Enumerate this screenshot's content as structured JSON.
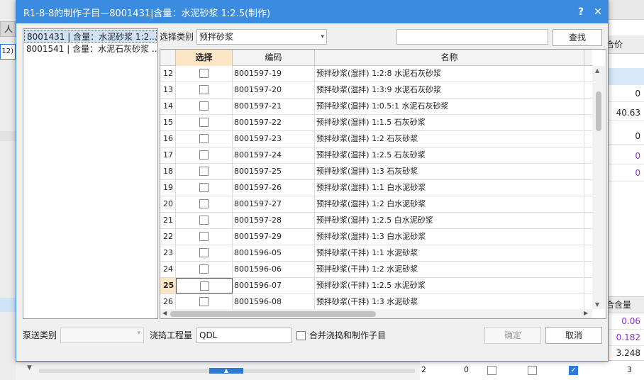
{
  "dialog": {
    "title": "R1-8-8的制作子目—8001431|含量：水泥砂浆 1:2.5(制作)",
    "help_glyph": "?",
    "close_glyph": "✕",
    "accent_color": "#3b8ce0"
  },
  "left_list": {
    "items": [
      "8001431 | 含量：水泥砂浆 1:2....",
      "8001541 | 含量：水泥石灰砂浆 ..."
    ]
  },
  "filter": {
    "category_label": "选择类别",
    "category_value": "预拌砂浆",
    "search_value": "",
    "search_button": "查找"
  },
  "grid": {
    "headers": [
      "",
      "选择",
      "编码",
      "名称"
    ],
    "current_row": "25",
    "rows": [
      {
        "num": "12",
        "code": "8001597-19",
        "name": "预拌砂浆(湿拌) 1:2:8 水泥石灰砂浆"
      },
      {
        "num": "13",
        "code": "8001597-20",
        "name": "预拌砂浆(湿拌) 1:3:9 水泥石灰砂浆"
      },
      {
        "num": "14",
        "code": "8001597-21",
        "name": "预拌砂浆(湿拌) 1:0.5:1 水泥石灰砂浆"
      },
      {
        "num": "15",
        "code": "8001597-22",
        "name": "预拌砂浆(湿拌) 1:1.5 石灰砂浆"
      },
      {
        "num": "16",
        "code": "8001597-23",
        "name": "预拌砂浆(湿拌) 1:2 石灰砂浆"
      },
      {
        "num": "17",
        "code": "8001597-24",
        "name": "预拌砂浆(湿拌) 1:2.5 石灰砂浆"
      },
      {
        "num": "18",
        "code": "8001597-25",
        "name": "预拌砂浆(湿拌) 1:3 石灰砂浆"
      },
      {
        "num": "19",
        "code": "8001597-26",
        "name": "预拌砂浆(湿拌) 1:1 白水泥砂浆"
      },
      {
        "num": "20",
        "code": "8001597-27",
        "name": "预拌砂浆(湿拌) 1:2 白水泥砂浆"
      },
      {
        "num": "21",
        "code": "8001597-28",
        "name": "预拌砂浆(湿拌) 1:2.5 白水泥砂浆"
      },
      {
        "num": "22",
        "code": "8001597-29",
        "name": "预拌砂浆(湿拌) 1:3 白水泥砂浆"
      },
      {
        "num": "23",
        "code": "8001596-05",
        "name": "预拌砂浆(干拌) 1:1 水泥砂浆"
      },
      {
        "num": "24",
        "code": "8001596-06",
        "name": "预拌砂浆(干拌) 1:2 水泥砂浆"
      },
      {
        "num": "25",
        "code": "8001596-07",
        "name": "预拌砂浆(干拌) 1:2.5 水泥砂浆"
      },
      {
        "num": "26",
        "code": "8001596-08",
        "name": "预拌砂浆(干拌) 1:3 水泥砂浆"
      }
    ]
  },
  "bottom": {
    "pump_label": "泵送类别",
    "pump_value": "",
    "pour_label": "浇捣工程量",
    "pour_value": "QDL",
    "merge_label": "合并浇捣和制作子目",
    "ok_button": "确定",
    "cancel_button": "取消"
  },
  "background": {
    "left_tab": "人",
    "left_input": "12)",
    "right_header": "价",
    "right_header_prefix": "合",
    "right_values": [
      "0",
      "40.63",
      "0",
      "0",
      "0"
    ],
    "right_header2": "合含量",
    "right_values2": [
      "0.06",
      "0.182",
      "3.248"
    ],
    "bottom_row_num": "2",
    "bottom_row_val": "0",
    "bottom_row_last": "3"
  }
}
